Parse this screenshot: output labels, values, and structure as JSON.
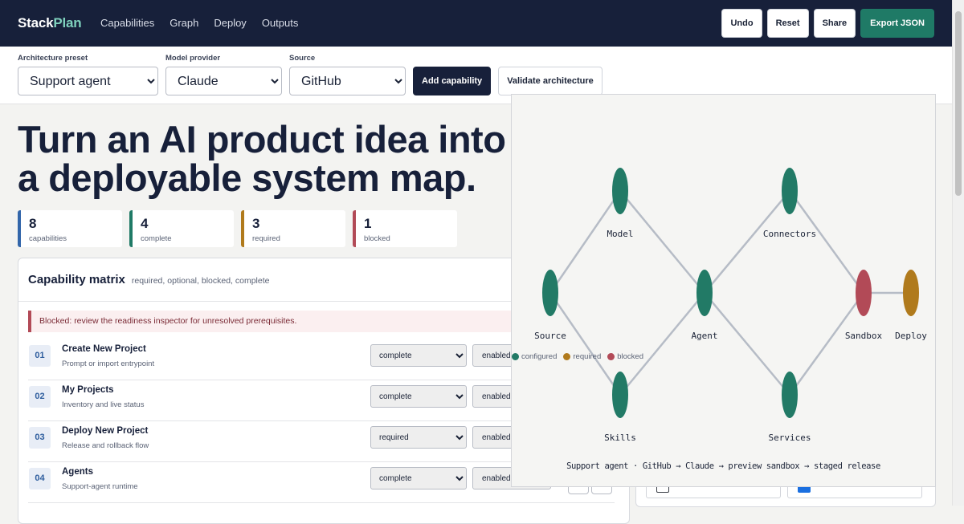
{
  "brand": {
    "part1": "Stack",
    "part2": "Plan"
  },
  "nav": {
    "capabilities": "Capabilities",
    "graph": "Graph",
    "deploy": "Deploy",
    "outputs": "Outputs"
  },
  "toolbar": {
    "undo": "Undo",
    "reset": "Reset",
    "share": "Share",
    "export": "Export JSON"
  },
  "controls": {
    "preset": {
      "label": "Architecture preset",
      "value": "Support agent"
    },
    "model": {
      "label": "Model provider",
      "value": "Claude"
    },
    "source": {
      "label": "Source",
      "value": "GitHub"
    },
    "add_capability": "Add capability",
    "validate": "Validate architecture"
  },
  "hero": {
    "line1": "Turn an AI product idea into",
    "line2": "a deployable system map."
  },
  "stats": [
    {
      "value": "8",
      "label": "capabilities",
      "color": "#3366aa"
    },
    {
      "value": "4",
      "label": "complete",
      "color": "#1f7a66"
    },
    {
      "value": "3",
      "label": "required",
      "color": "#b07a1c"
    },
    {
      "value": "1",
      "label": "blocked",
      "color": "#b24a57"
    }
  ],
  "matrix": {
    "title": "Capability matrix",
    "subtitle": "required, optional, blocked, complete",
    "alert": "Blocked: review the readiness inspector for unresolved prerequisites.",
    "rows": [
      {
        "index": "01",
        "title": "Create New Project",
        "desc": "Prompt or import entrypoint",
        "state": "complete",
        "toggle": "enabled"
      },
      {
        "index": "02",
        "title": "My Projects",
        "desc": "Inventory and live status",
        "state": "complete",
        "toggle": "enabled"
      },
      {
        "index": "03",
        "title": "Deploy New Project",
        "desc": "Release and rollback flow",
        "state": "required",
        "toggle": "enabled"
      },
      {
        "index": "04",
        "title": "Agents",
        "desc": "Support-agent runtime",
        "state": "complete",
        "toggle": "enabled"
      }
    ]
  },
  "graph": {
    "nodes": [
      {
        "label": "Model",
        "status": "configured"
      },
      {
        "label": "Connectors",
        "status": "configured"
      },
      {
        "label": "Source",
        "status": "configured"
      },
      {
        "label": "Agent",
        "status": "configured"
      },
      {
        "label": "Sandbox",
        "status": "blocked"
      },
      {
        "label": "Deploy",
        "status": "required"
      },
      {
        "label": "Skills",
        "status": "configured"
      },
      {
        "label": "Services",
        "status": "configured"
      }
    ],
    "legend": {
      "configured": "configured",
      "required": "required",
      "blocked": "blocked"
    },
    "colors": {
      "configured": "#227a66",
      "required": "#b07a1c",
      "blocked": "#b24a57",
      "edge": "#b6bcc6"
    },
    "caption": "Support agent · GitHub → Claude → preview sandbox → staged release"
  }
}
